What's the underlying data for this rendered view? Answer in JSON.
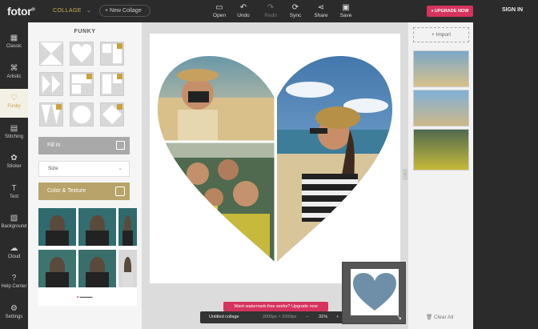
{
  "app": {
    "logo": "fotor",
    "logo_mark": "®",
    "mode": "COLLAGE",
    "new_collage": "+ New Collage"
  },
  "toolbar": [
    {
      "label": "Open",
      "icon": "open-icon",
      "glyph": "▭",
      "enabled": true
    },
    {
      "label": "Undo",
      "icon": "undo-icon",
      "glyph": "↶",
      "enabled": true
    },
    {
      "label": "Redo",
      "icon": "redo-icon",
      "glyph": "↷",
      "enabled": false
    },
    {
      "label": "Sync",
      "icon": "sync-icon",
      "glyph": "⟳",
      "enabled": true
    },
    {
      "label": "Share",
      "icon": "share-icon",
      "glyph": "⋖",
      "enabled": true
    },
    {
      "label": "Save",
      "icon": "save-icon",
      "glyph": "▣",
      "enabled": true
    }
  ],
  "upgrade": "UPGRADE NOW",
  "signin": "SIGN IN",
  "nav": [
    {
      "label": "Classic",
      "icon": "classic-grid-icon",
      "glyph": "▦"
    },
    {
      "label": "Artistic",
      "icon": "artistic-icon",
      "glyph": "⌘"
    },
    {
      "label": "Funky",
      "icon": "heart-icon",
      "glyph": "♡",
      "active": true
    },
    {
      "label": "Stitching",
      "icon": "stitching-icon",
      "glyph": "▤"
    },
    {
      "label": "Sticker",
      "icon": "sticker-icon",
      "glyph": "✿"
    },
    {
      "label": "Text",
      "icon": "text-icon",
      "glyph": "T"
    },
    {
      "label": "Background",
      "icon": "background-icon",
      "glyph": "▧"
    },
    {
      "label": "Cloud",
      "icon": "cloud-icon",
      "glyph": "☁"
    },
    {
      "label": "Help Center",
      "icon": "help-icon",
      "glyph": "?"
    },
    {
      "label": "Settings",
      "icon": "settings-icon",
      "glyph": "⚙"
    }
  ],
  "panel": {
    "title": "FUNKY",
    "fill_in": "Fill in",
    "size": "Size",
    "color_texture": "Color & Texture"
  },
  "canvas": {
    "name": "Untitled collage",
    "dimensions": "2000px × 2000px",
    "zoom": "31%"
  },
  "watermark_banner": "Want watermark-free works? Upgrade now",
  "right": {
    "import": "+ Import",
    "clear_all": "Clear All"
  },
  "colors": {
    "accent": "#c9a13d",
    "upgrade": "#d6335f"
  }
}
